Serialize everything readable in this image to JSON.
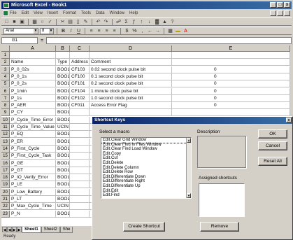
{
  "window": {
    "title": "Microsoft Excel - Book1",
    "controls": [
      "_",
      "□",
      "x"
    ]
  },
  "menu": [
    "File",
    "Edit",
    "View",
    "Insert",
    "Format",
    "Tools",
    "Data",
    "Window",
    "Help"
  ],
  "toolbar2": {
    "font": "Arial",
    "size": "8"
  },
  "formula_bar": {
    "name_box": "G1",
    "fx": "="
  },
  "columns": [
    "A",
    "B",
    "C",
    "D",
    "E"
  ],
  "rows": [
    {
      "n": "1",
      "a": "",
      "b": "",
      "c": "",
      "d": "",
      "e": ""
    },
    {
      "n": "2",
      "a": "Name",
      "b": "Type",
      "c": "Address",
      "d": "Comment",
      "e": ""
    },
    {
      "n": "3",
      "a": "P_0_02s",
      "b": "BOOL",
      "c": "CF103",
      "d": "0.02 second clock pulse bit",
      "e": "0"
    },
    {
      "n": "4",
      "a": "P_0_1s",
      "b": "BOOL",
      "c": "CF100",
      "d": "0.1 second clock pulse bit",
      "e": "0"
    },
    {
      "n": "5",
      "a": "P_0_2s",
      "b": "BOOL",
      "c": "CF101",
      "d": "0.2 second clock pulse bit",
      "e": "0"
    },
    {
      "n": "6",
      "a": "P_1min",
      "b": "BOOL",
      "c": "CF104",
      "d": "1 minute clock pulse bit",
      "e": "0"
    },
    {
      "n": "7",
      "a": "P_1s",
      "b": "BOOL",
      "c": "CF102",
      "d": "1.0 second clock pulse bit",
      "e": "0"
    },
    {
      "n": "8",
      "a": "P_AER",
      "b": "BOOL",
      "c": "CF011",
      "d": "Access Error Flag",
      "e": "0"
    },
    {
      "n": "9",
      "a": "P_CY",
      "b": "BOOL",
      "c": "",
      "d": "",
      "e": ""
    },
    {
      "n": "10",
      "a": "P_Cycle_Time_Error",
      "b": "BOOL",
      "c": "",
      "d": "",
      "e": ""
    },
    {
      "n": "11",
      "a": "P_Cycle_Time_Value",
      "b": "UCIN",
      "c": "",
      "d": "",
      "e": ""
    },
    {
      "n": "12",
      "a": "P_EQ",
      "b": "BOOL",
      "c": "",
      "d": "",
      "e": ""
    },
    {
      "n": "13",
      "a": "P_ER",
      "b": "BOOL",
      "c": "",
      "d": "",
      "e": ""
    },
    {
      "n": "14",
      "a": "P_First_Cycle",
      "b": "BOOL",
      "c": "",
      "d": "",
      "e": ""
    },
    {
      "n": "15",
      "a": "P_First_Cycle_Task",
      "b": "BOOL",
      "c": "",
      "d": "",
      "e": ""
    },
    {
      "n": "16",
      "a": "P_GE",
      "b": "BOOL",
      "c": "",
      "d": "",
      "e": ""
    },
    {
      "n": "17",
      "a": "P_GT",
      "b": "BOOL",
      "c": "",
      "d": "",
      "e": ""
    },
    {
      "n": "18",
      "a": "P_IO_Verify_Error",
      "b": "BOOL",
      "c": "",
      "d": "",
      "e": ""
    },
    {
      "n": "19",
      "a": "P_LE",
      "b": "BOOL",
      "c": "",
      "d": "",
      "e": ""
    },
    {
      "n": "20",
      "a": "P_Low_Battery",
      "b": "BOOL",
      "c": "",
      "d": "",
      "e": ""
    },
    {
      "n": "21",
      "a": "P_LT",
      "b": "BOOL",
      "c": "",
      "d": "",
      "e": ""
    },
    {
      "n": "22",
      "a": "P_Max_Cycle_Time",
      "b": "UCIN",
      "c": "",
      "d": "",
      "e": ""
    },
    {
      "n": "23",
      "a": "P_N",
      "b": "BOOL",
      "c": "",
      "d": "",
      "e": ""
    }
  ],
  "sheet_tabs": [
    "Sheet1",
    "Sheet2",
    "She"
  ],
  "status": "Ready",
  "dialog": {
    "title": "Shortcut Keys",
    "select_label": "Select a macro",
    "description_label": "Description",
    "assigned_label": "Assigned shortcuts",
    "macros": [
      "Edit.Clear Grid Window",
      "Edit.Clear Find In Files Window",
      "Edit.Clear Find Load Window",
      "Edit.Copy",
      "Edit.Cut",
      "Edit.Delete",
      "Edit.Delete Column",
      "Edit.Delete Row",
      "Edit.Differentiate Down",
      "Edit.Differentiate Right",
      "Edit.Differentiate Up",
      "Edit.Edit",
      "Edit.Find"
    ],
    "buttons": {
      "ok": "OK",
      "cancel": "Cancel",
      "reset_all": "Reset All",
      "create": "Create Shortcut",
      "remove": "Remove"
    }
  }
}
